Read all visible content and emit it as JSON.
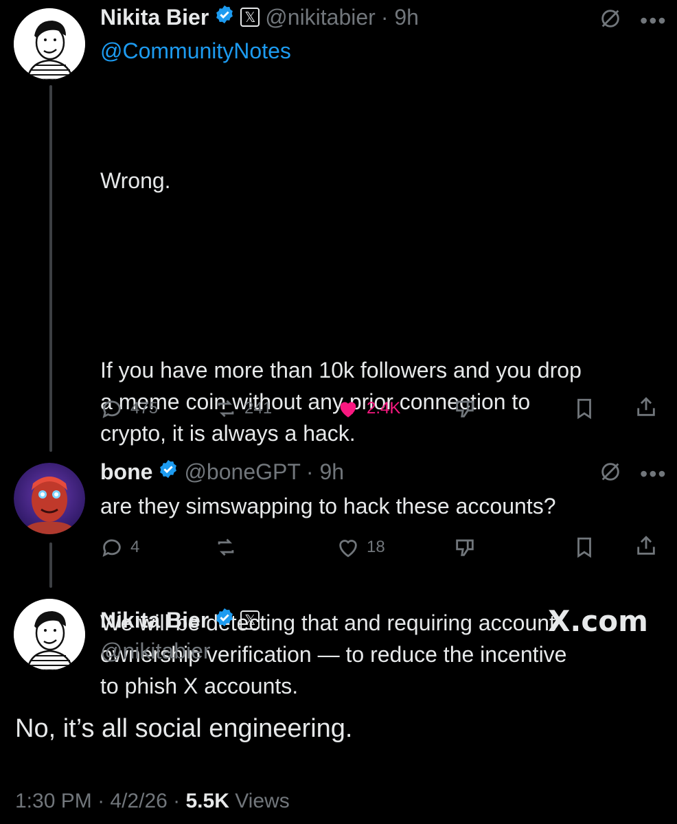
{
  "tweet1": {
    "name": "Nikita Bier",
    "handle": "@nikitabier",
    "time": "· 9h",
    "mention": "@CommunityNotes",
    "p1": "Wrong.",
    "p2": "If you have more than 10k followers and you drop\na meme coin without any prior connection to\ncrypto, it is always a hack.",
    "p3": "We will be detecting that and requiring account\nownership verification — to reduce the incentive\nto phish X accounts.",
    "replies": "475",
    "reposts": "241",
    "likes": "2.4K"
  },
  "tweet2": {
    "name": "bone",
    "handle": "@boneGPT",
    "time": "· 9h",
    "text": "are they simswapping to hack these accounts?",
    "replies": "4",
    "likes": "18"
  },
  "main": {
    "name": "Nikita Bier",
    "handle": "@nikitabier",
    "watermark": "X.com",
    "text": "No, it’s all social engineering.",
    "time": "1:30 PM",
    "date": "4/2/26",
    "views_count": "5.5K",
    "views_label": "Views"
  },
  "icons": {
    "verified": "verified-badge-icon",
    "x_badge": "x-affiliate-badge-icon",
    "grok": "grok-icon",
    "more": "more-icon",
    "reply": "reply-icon",
    "repost": "repost-icon",
    "like": "heart-icon",
    "dislike": "dislike-icon",
    "bookmark": "bookmark-icon",
    "share": "share-icon"
  },
  "colors": {
    "background": "#000000",
    "text": "#e7e9ea",
    "muted": "#71767b",
    "link": "#1d9bf0",
    "like": "#f91880"
  },
  "x_badge_glyph": "𝕏"
}
